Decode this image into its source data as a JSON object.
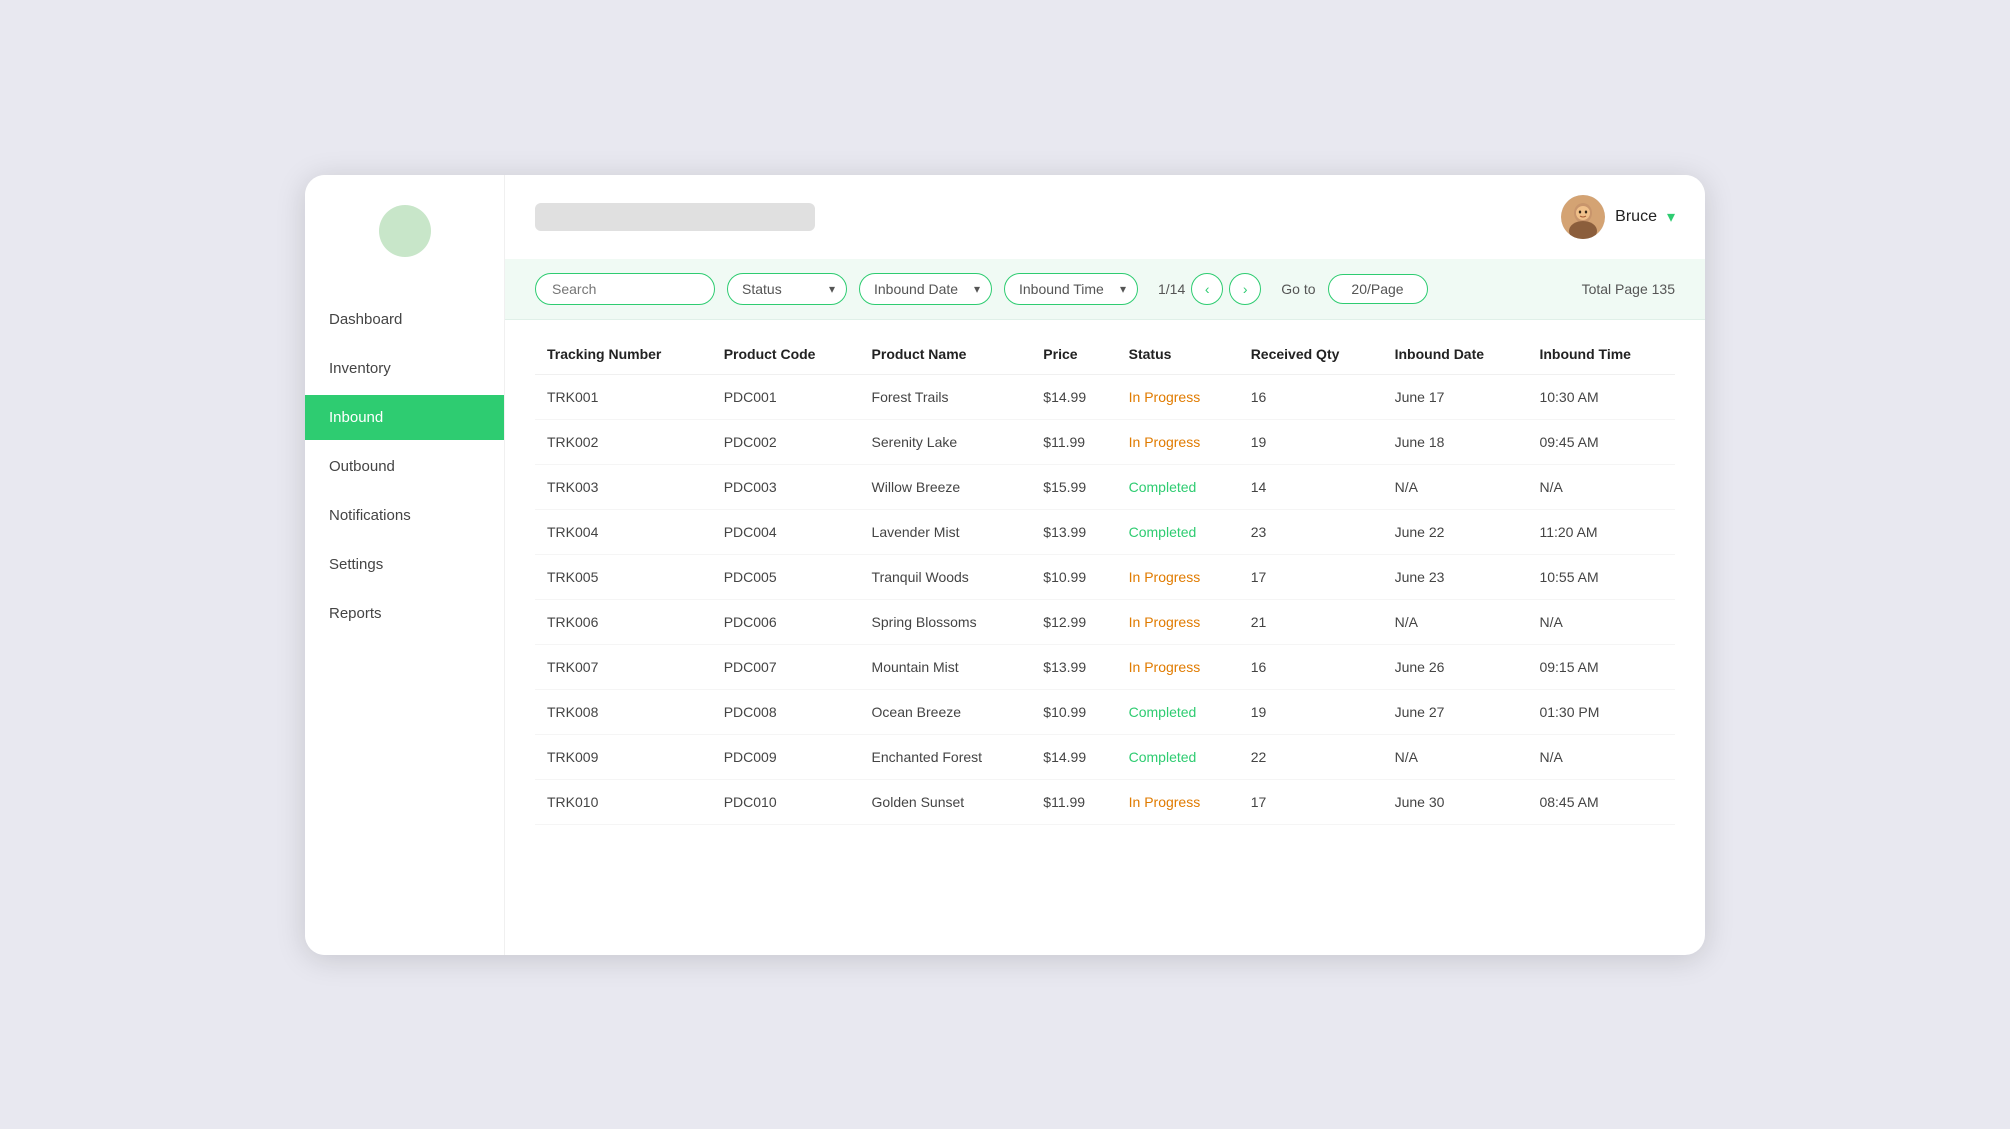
{
  "sidebar": {
    "logo_bg": "#c8e6c9",
    "items": [
      {
        "label": "Dashboard",
        "id": "dashboard",
        "active": false
      },
      {
        "label": "Inventory",
        "id": "inventory",
        "active": false
      },
      {
        "label": "Inbound",
        "id": "inbound",
        "active": true
      },
      {
        "label": "Outbound",
        "id": "outbound",
        "active": false
      },
      {
        "label": "Notifications",
        "id": "notifications",
        "active": false
      },
      {
        "label": "Settings",
        "id": "settings",
        "active": false
      },
      {
        "label": "Reports",
        "id": "reports",
        "active": false
      }
    ]
  },
  "header": {
    "user_name": "Bruce",
    "dropdown_icon": "▾"
  },
  "filter_bar": {
    "search_placeholder": "Search",
    "status_label": "Status",
    "inbound_date_label": "Inbound Date",
    "inbound_time_label": "Inbound Time",
    "pagination_current": "1/14",
    "goto_label": "Go to",
    "goto_value": "20/Page",
    "total_pages": "Total Page 135"
  },
  "table": {
    "columns": [
      "Tracking Number",
      "Product Code",
      "Product Name",
      "Price",
      "Status",
      "Received Qty",
      "Inbound Date",
      "Inbound Time"
    ],
    "rows": [
      {
        "tracking": "TRK001",
        "code": "PDC001",
        "name": "Forest Trails",
        "price": "$14.99",
        "status": "In Progress",
        "qty": "16",
        "date": "June 17",
        "time": "10:30 AM"
      },
      {
        "tracking": "TRK002",
        "code": "PDC002",
        "name": "Serenity Lake",
        "price": "$11.99",
        "status": "In Progress",
        "qty": "19",
        "date": "June 18",
        "time": "09:45 AM"
      },
      {
        "tracking": "TRK003",
        "code": "PDC003",
        "name": "Willow Breeze",
        "price": "$15.99",
        "status": "Completed",
        "qty": "14",
        "date": "N/A",
        "time": "N/A"
      },
      {
        "tracking": "TRK004",
        "code": "PDC004",
        "name": "Lavender Mist",
        "price": "$13.99",
        "status": "Completed",
        "qty": "23",
        "date": "June 22",
        "time": "11:20 AM"
      },
      {
        "tracking": "TRK005",
        "code": "PDC005",
        "name": "Tranquil Woods",
        "price": "$10.99",
        "status": "In Progress",
        "qty": "17",
        "date": "June 23",
        "time": "10:55 AM"
      },
      {
        "tracking": "TRK006",
        "code": "PDC006",
        "name": "Spring Blossoms",
        "price": "$12.99",
        "status": "In Progress",
        "qty": "21",
        "date": "N/A",
        "time": "N/A"
      },
      {
        "tracking": "TRK007",
        "code": "PDC007",
        "name": "Mountain Mist",
        "price": "$13.99",
        "status": "In Progress",
        "qty": "16",
        "date": "June 26",
        "time": "09:15 AM"
      },
      {
        "tracking": "TRK008",
        "code": "PDC008",
        "name": "Ocean Breeze",
        "price": "$10.99",
        "status": "Completed",
        "qty": "19",
        "date": "June 27",
        "time": "01:30 PM"
      },
      {
        "tracking": "TRK009",
        "code": "PDC009",
        "name": "Enchanted Forest",
        "price": "$14.99",
        "status": "Completed",
        "qty": "22",
        "date": "N/A",
        "time": "N/A"
      },
      {
        "tracking": "TRK010",
        "code": "PDC010",
        "name": "Golden Sunset",
        "price": "$11.99",
        "status": "In Progress",
        "qty": "17",
        "date": "June 30",
        "time": "08:45 AM"
      }
    ]
  }
}
